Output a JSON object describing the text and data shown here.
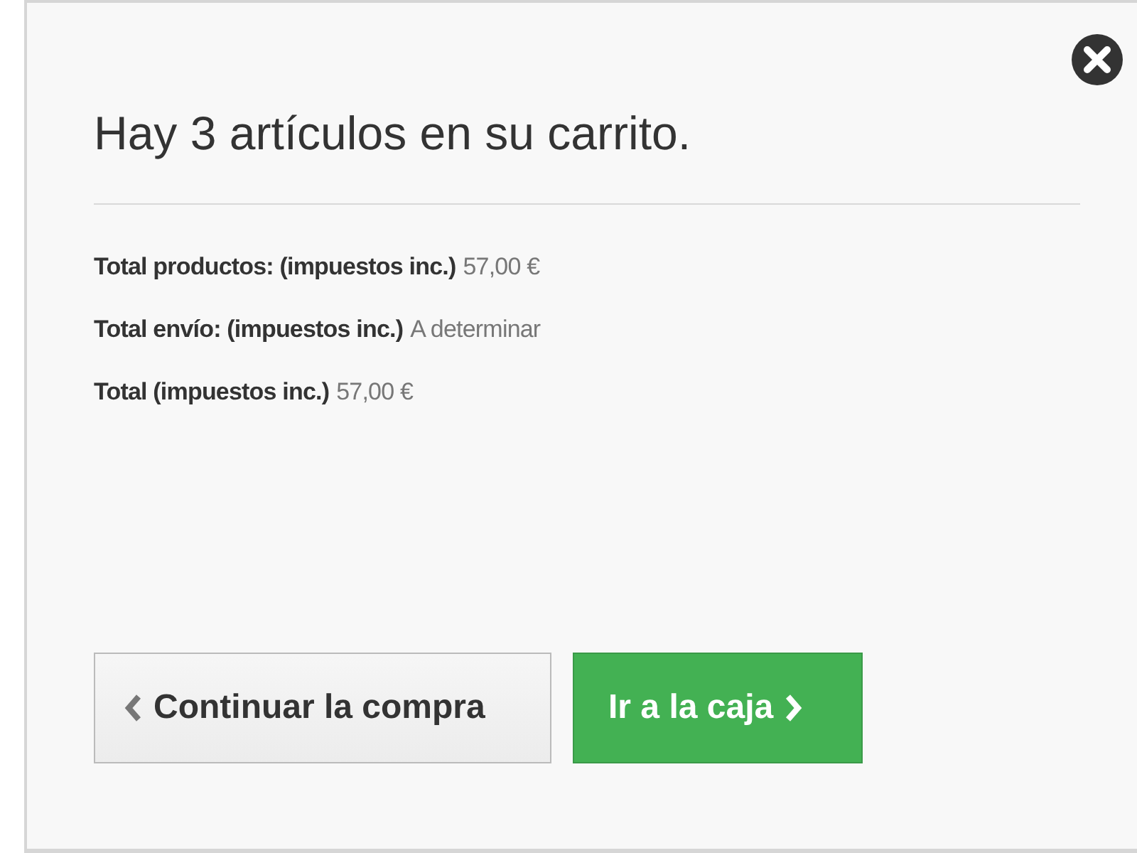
{
  "title": "Hay 3 artículos en su carrito.",
  "totals": [
    {
      "label": "Total productos: (impuestos inc.)",
      "value": "57,00 €"
    },
    {
      "label": "Total envío: (impuestos inc.)",
      "value": "A determinar"
    },
    {
      "label": "Total (impuestos inc.)",
      "value": "57,00 €"
    }
  ],
  "buttons": [
    {
      "kind": "back",
      "label": "Continuar la compra"
    },
    {
      "kind": "forward",
      "label": "Ir a la caja"
    }
  ]
}
